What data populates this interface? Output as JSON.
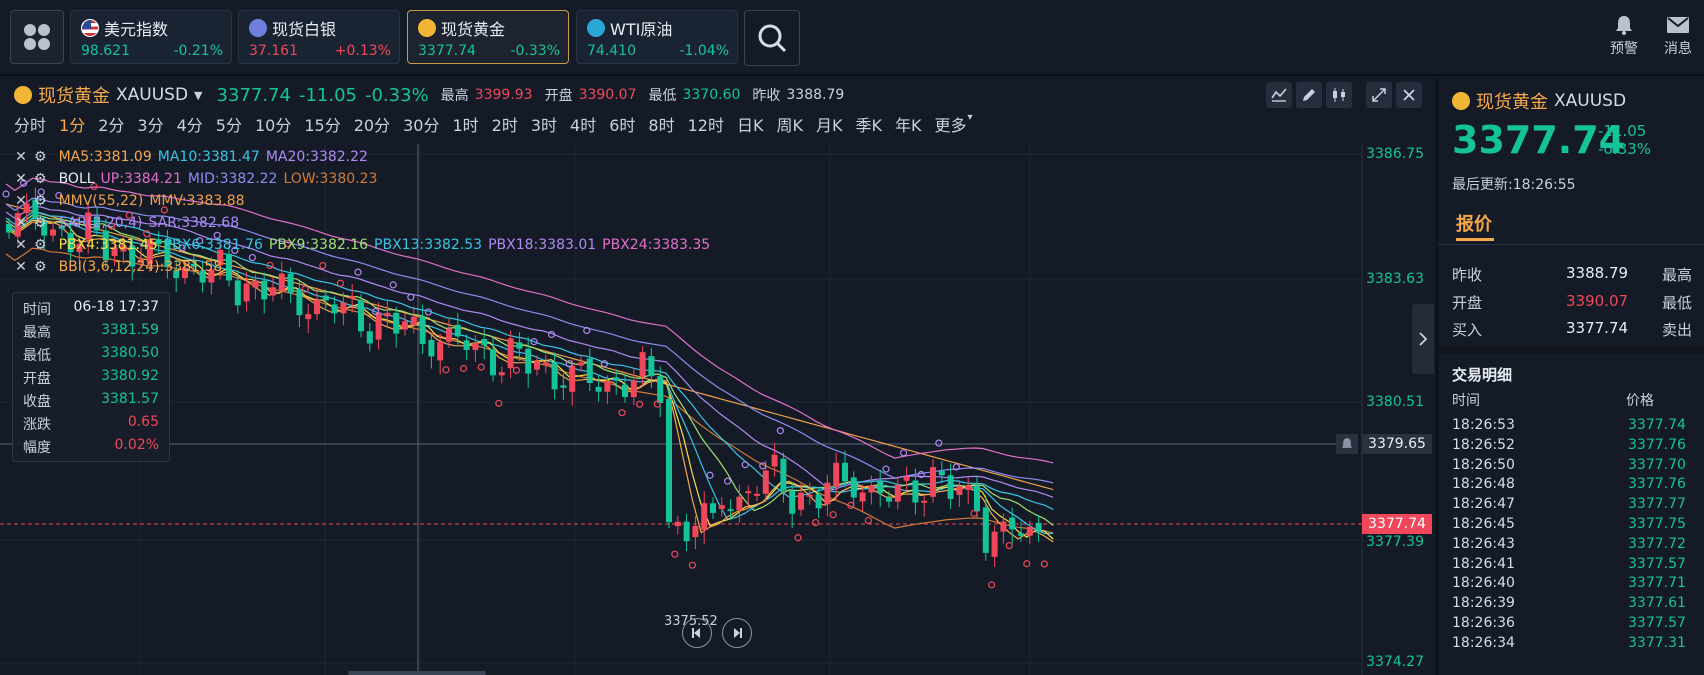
{
  "topbar": {
    "quotes": [
      {
        "name": "美元指数",
        "price": "98.621",
        "change": "-0.21%",
        "icon": "us-flag-icon"
      },
      {
        "name": "现货白银",
        "price": "37.161",
        "change": "+0.13%",
        "icon": "silver-icon"
      },
      {
        "name": "现货黄金",
        "price": "3377.74",
        "change": "-0.33%",
        "icon": "gold-icon"
      },
      {
        "name": "WTI原油",
        "price": "74.410",
        "change": "-1.04%",
        "icon": "oil-icon"
      }
    ],
    "alert_label": "预警",
    "message_label": "消息"
  },
  "symbol": {
    "name": "现货黄金",
    "code": "XAUUSD",
    "price": "3377.74",
    "change": "-11.05",
    "change_pct": "-0.33%",
    "high_label": "最高",
    "high": "3399.93",
    "open_label": "开盘",
    "open": "3390.07",
    "low_label": "最低",
    "low": "3370.60",
    "prev_label": "昨收",
    "prev": "3388.79"
  },
  "timeframes": [
    "分时",
    "1分",
    "2分",
    "3分",
    "4分",
    "5分",
    "10分",
    "15分",
    "20分",
    "30分",
    "1时",
    "2时",
    "3时",
    "4时",
    "6时",
    "8时",
    "12时",
    "日K",
    "周K",
    "月K",
    "季K",
    "年K",
    "更多"
  ],
  "selected_timeframe": "1分",
  "indicators": {
    "ma": [
      {
        "t": "MA5:3381.09",
        "c": "#f7a84a"
      },
      {
        "t": "MA10:3381.47",
        "c": "#37c6e6"
      },
      {
        "t": "MA20:3382.22",
        "c": "#b089f2"
      }
    ],
    "boll": [
      {
        "t": "BOLL",
        "c": "#e8edf3"
      },
      {
        "t": "UP:3384.21",
        "c": "#e070c9"
      },
      {
        "t": "MID:3382.22",
        "c": "#8c8cf0"
      },
      {
        "t": "LOW:3380.23",
        "c": "#d07a3a"
      }
    ],
    "mmv": [
      {
        "t": "MMV(55,22)",
        "c": "#e8a24a"
      },
      {
        "t": "MMV:3383.88",
        "c": "#f0a04a"
      }
    ],
    "sar": [
      {
        "t": "SAR(2,20,4)",
        "c": "#b089f2"
      },
      {
        "t": "SAR:3382.68",
        "c": "#b089f2"
      }
    ],
    "pbx": [
      {
        "t": "PBX4:3381.45",
        "c": "#f7e04a"
      },
      {
        "t": "PBX6:3381.76",
        "c": "#37c6e6"
      },
      {
        "t": "PBX9:3382.16",
        "c": "#a0e070"
      },
      {
        "t": "PBX13:3382.53",
        "c": "#37c6e6"
      },
      {
        "t": "PBX18:3383.01",
        "c": "#b089f2"
      },
      {
        "t": "PBX24:3383.35",
        "c": "#e070c9"
      }
    ],
    "bbi": [
      {
        "t": "BBI(3,6,12,24):3381.58",
        "c": "#f7a84a"
      }
    ]
  },
  "tooltip": {
    "time_label": "时间",
    "time": "06-18 17:37",
    "high_label": "最高",
    "high": "3381.59",
    "low_label": "最低",
    "low": "3380.50",
    "open_label": "开盘",
    "open": "3380.92",
    "close_label": "收盘",
    "close": "3381.57",
    "chg_label": "涨跌",
    "chg": "0.65",
    "pct_label": "幅度",
    "pct": "0.02%"
  },
  "yaxis": [
    "3386.75",
    "3383.63",
    "3380.51",
    "3377.39",
    "3374.27"
  ],
  "current_price_tag": "3377.74",
  "crosshair_price_tag": "3379.65",
  "min_marker": "3375.52",
  "right_panel": {
    "name": "现货黄金",
    "code": "XAUUSD",
    "price": "3377.74",
    "change": "-11.05",
    "change_pct": "-0.33%",
    "updated": "最后更新:18:26:55",
    "tab": "报价",
    "rows": [
      {
        "l": "昨收",
        "v": "3388.79",
        "r": "最高",
        "vc": "#e8edf3"
      },
      {
        "l": "开盘",
        "v": "3390.07",
        "r": "最低",
        "vc": "#f0485a"
      },
      {
        "l": "买入",
        "v": "3377.74",
        "r": "卖出",
        "vc": "#e8edf3"
      }
    ],
    "trade_title": "交易明细",
    "trade_h_time": "时间",
    "trade_h_price": "价格",
    "trades": [
      [
        "18:26:53",
        "3377.74"
      ],
      [
        "18:26:52",
        "3377.76"
      ],
      [
        "18:26:50",
        "3377.70"
      ],
      [
        "18:26:48",
        "3377.76"
      ],
      [
        "18:26:47",
        "3377.77"
      ],
      [
        "18:26:45",
        "3377.75"
      ],
      [
        "18:26:43",
        "3377.72"
      ],
      [
        "18:26:41",
        "3377.57"
      ],
      [
        "18:26:40",
        "3377.71"
      ],
      [
        "18:26:39",
        "3377.61"
      ],
      [
        "18:26:36",
        "3377.57"
      ],
      [
        "18:26:34",
        "3377.31"
      ]
    ]
  },
  "colors": {
    "up": "#f0485a",
    "down": "#15c39a",
    "accent": "#f7a84a"
  }
}
